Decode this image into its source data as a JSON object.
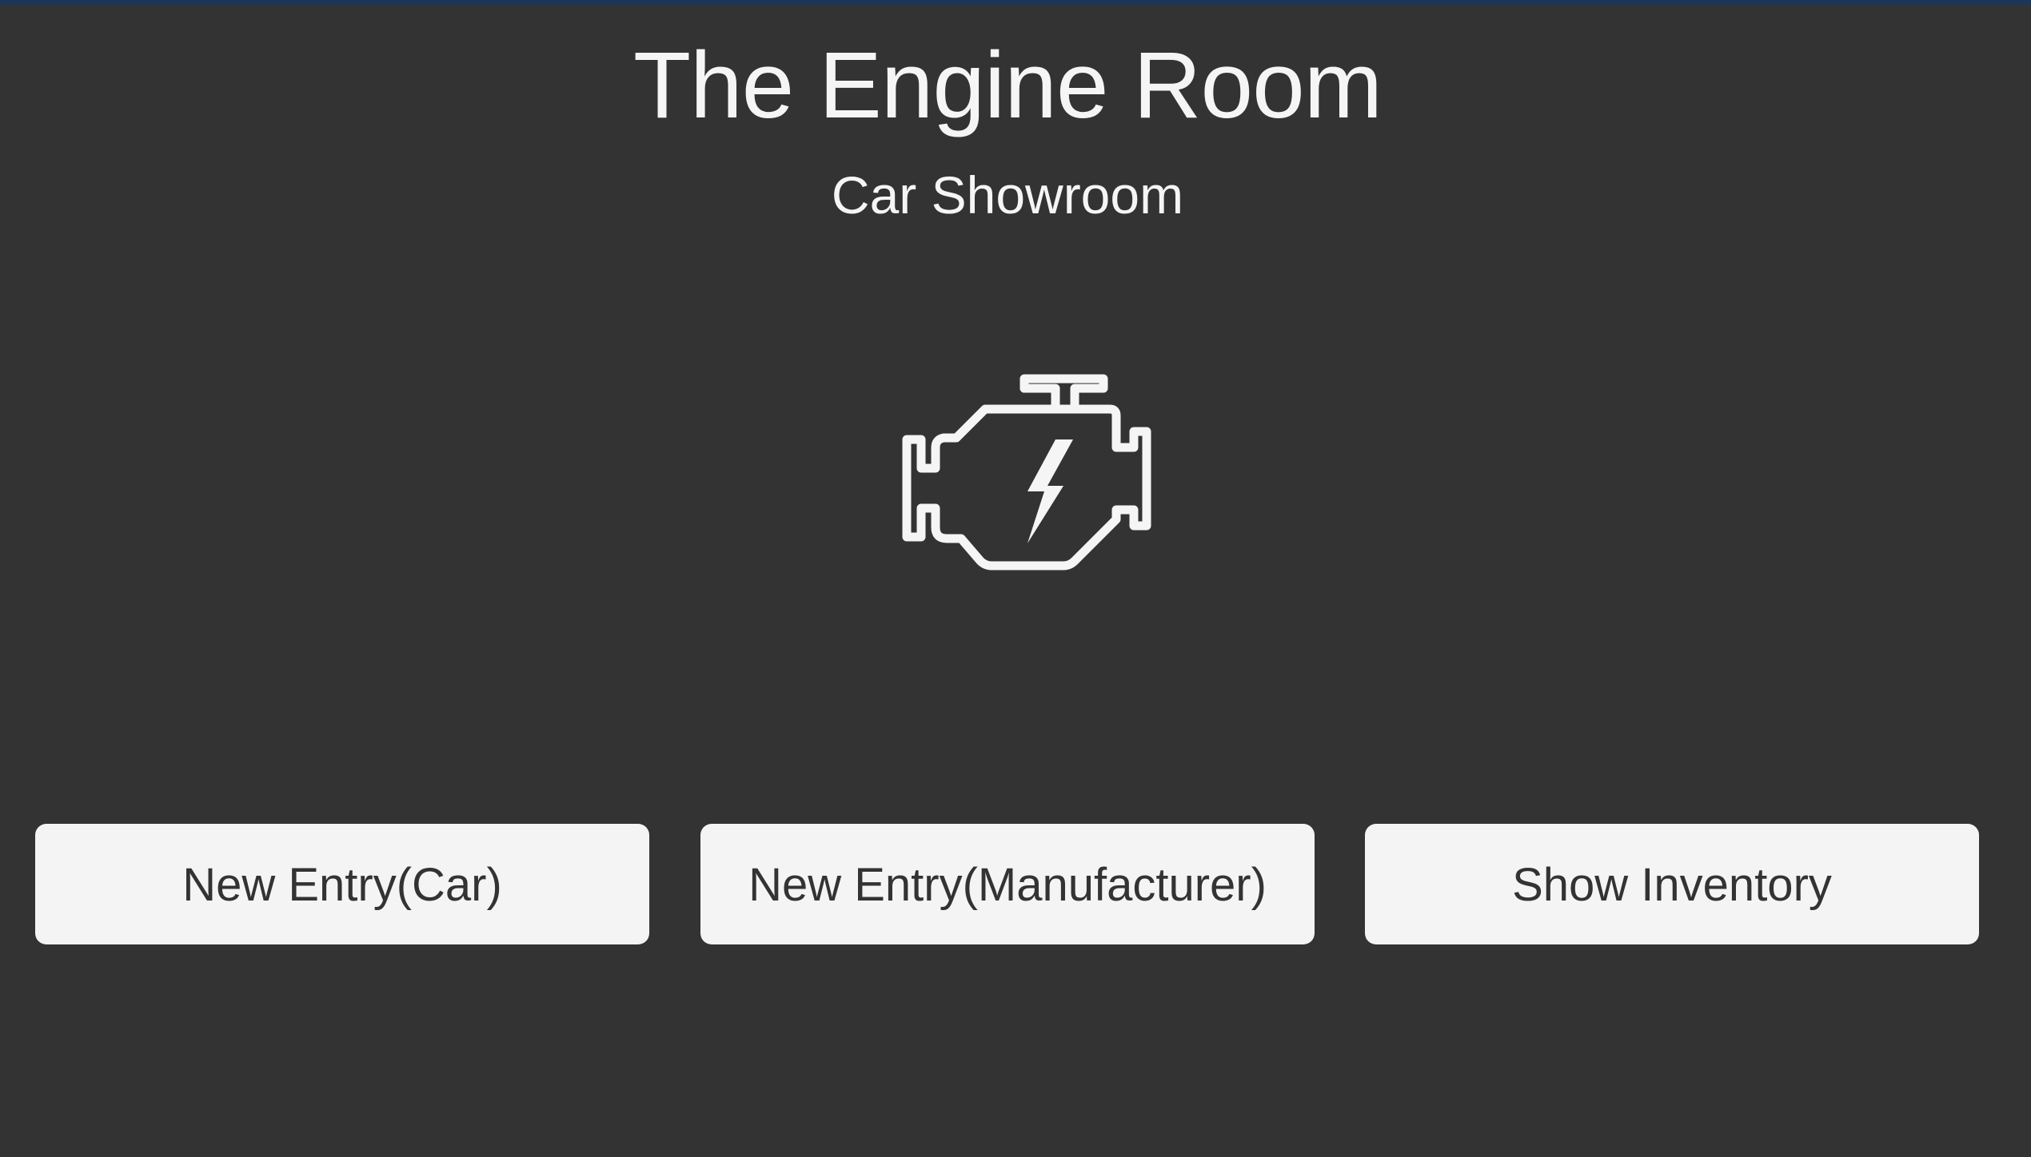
{
  "header": {
    "title": "The Engine Room",
    "subtitle": "Car Showroom"
  },
  "hero": {
    "icon": "engine-check-icon"
  },
  "actions": {
    "new_car_label": "New Entry(Car)",
    "new_manufacturer_label": "New Entry(Manufacturer)",
    "show_inventory_label": "Show Inventory"
  },
  "colors": {
    "background": "#333333",
    "accent_bar": "#1d3557",
    "button_bg": "#f4f4f4",
    "text_light": "#f5f5f5",
    "text_dark": "#333333"
  }
}
